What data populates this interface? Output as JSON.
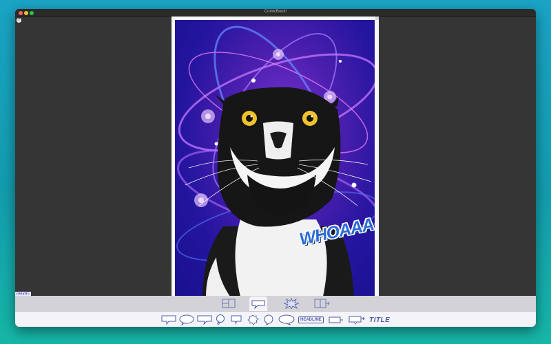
{
  "window": {
    "title": "ComicBook!",
    "help_label": "?"
  },
  "canvas": {
    "sound_effect_text": "WHOAAA",
    "create_tag": "CREATE !"
  },
  "tabs": [
    {
      "name": "layouts-tab",
      "icon": "panel-layout-icon",
      "active": false
    },
    {
      "name": "balloons-tab",
      "icon": "speech-balloon-icon",
      "active": true
    },
    {
      "name": "effects-tab",
      "icon": "burst-effect-icon",
      "active": false
    },
    {
      "name": "pages-tab",
      "icon": "add-page-icon",
      "active": false
    }
  ],
  "tools": {
    "headline_label": "HEADLINE",
    "title_label": "TITLE"
  },
  "colors": {
    "accent": "#4b5ba7",
    "toolbar_bg": "#d2d2d7",
    "tray_bg": "#f4f4f8",
    "window_bg": "#353535"
  }
}
